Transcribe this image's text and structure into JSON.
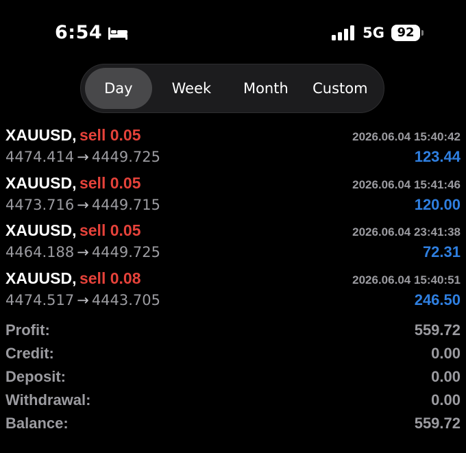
{
  "status_bar": {
    "time": "6:54",
    "network": "5G",
    "battery": "92"
  },
  "tabs": [
    {
      "label": "Day",
      "active": true
    },
    {
      "label": "Week",
      "active": false
    },
    {
      "label": "Month",
      "active": false
    },
    {
      "label": "Custom",
      "active": false
    }
  ],
  "trades": [
    {
      "symbol": "XAUUSD,",
      "side": "sell 0.05",
      "timestamp": "2026.06.04 15:40:42",
      "open_price": "4474.414",
      "close_price": "4449.725",
      "profit": "123.44"
    },
    {
      "symbol": "XAUUSD,",
      "side": "sell 0.05",
      "timestamp": "2026.06.04 15:41:46",
      "open_price": "4473.716",
      "close_price": "4449.715",
      "profit": "120.00"
    },
    {
      "symbol": "XAUUSD,",
      "side": "sell 0.05",
      "timestamp": "2026.06.04 23:41:38",
      "open_price": "4464.188",
      "close_price": "4449.725",
      "profit": "72.31"
    },
    {
      "symbol": "XAUUSD,",
      "side": "sell 0.08",
      "timestamp": "2026.06.04 15:40:51",
      "open_price": "4474.517",
      "close_price": "4443.705",
      "profit": "246.50"
    }
  ],
  "arrow": "→",
  "summary": [
    {
      "label": "Profit:",
      "value": "559.72"
    },
    {
      "label": "Credit:",
      "value": "0.00"
    },
    {
      "label": "Deposit:",
      "value": "0.00"
    },
    {
      "label": "Withdrawal:",
      "value": "0.00"
    },
    {
      "label": "Balance:",
      "value": "559.72"
    }
  ],
  "colors": {
    "background": "#000000",
    "sell": "#e5423a",
    "profit": "#2f7fe0",
    "muted": "#9b9ba0"
  }
}
